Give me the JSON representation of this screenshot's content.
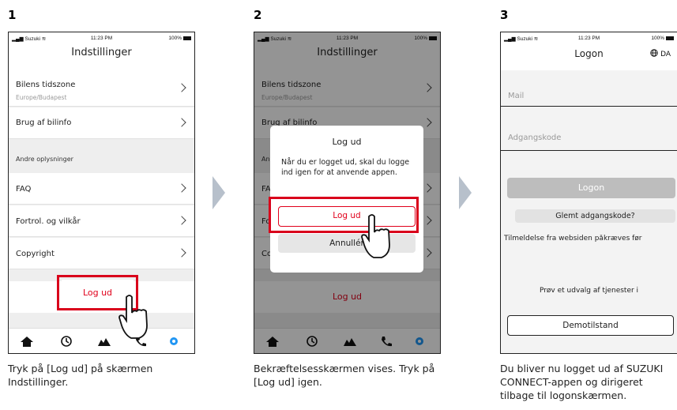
{
  "steps": [
    {
      "number": "1",
      "caption": "Tryk på [Log ud] på skærmen Indstillinger."
    },
    {
      "number": "2",
      "caption": "Bekræftelsesskærmen vises. Tryk på [Log ud] igen."
    },
    {
      "number": "3",
      "caption": "Du bliver nu logget ud af SUZUKI CONNECT-appen og dirigeret tilbage til logonskærmen."
    }
  ],
  "status_bar": {
    "carrier": "Suzuki",
    "time": "11:23 PM",
    "battery": "100%"
  },
  "settings": {
    "title": "Indstillinger",
    "timezone_label": "Bilens tidszone",
    "timezone_value": "Europe/Budapest",
    "vehicle_info": "Brug af bilinfo",
    "other_info_header": "Andre oplysninger",
    "faq": "FAQ",
    "privacy": "Fortrol. og vilkår",
    "copyright": "Copyright",
    "logout": "Log ud"
  },
  "dialog": {
    "title": "Log ud",
    "message": "Når du er logget ud, skal du logge ind igen for at anvende appen.",
    "confirm": "Log ud",
    "cancel": "Annullér"
  },
  "logon": {
    "title": "Logon",
    "language": "DA",
    "mail_placeholder": "Mail",
    "password_placeholder": "Adgangskode",
    "logon_button": "Logon",
    "forgot_password": "Glemt adgangskode?",
    "registration_note": "Tilmeldelse fra websiden påkræves før",
    "try_services": "Prøv et udvalg af tjenester i",
    "demo_button": "Demotilstand"
  },
  "colors": {
    "accent": "#2196f3",
    "highlight": "#d9001b",
    "logout_red": "#e0001b",
    "arrow": "#b7c0cb"
  },
  "tab_icons": [
    "home-icon",
    "history-icon",
    "map-icon",
    "phone-icon",
    "gear-icon"
  ]
}
